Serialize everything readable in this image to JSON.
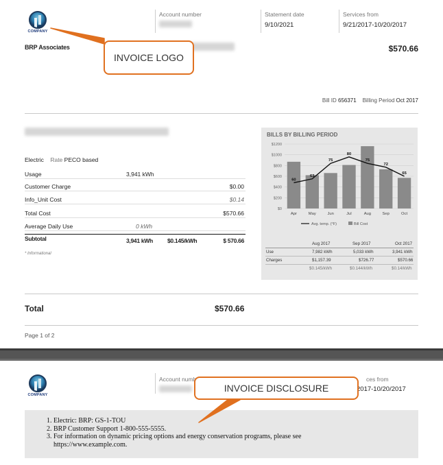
{
  "header": {
    "logo_text": "COMPANY",
    "account_label": "Account number",
    "statement_label": "Statement date",
    "statement_date": "9/10/2021",
    "services_label": "Services from",
    "services_range": "9/21/2017-10/20/2017",
    "company_name": "BRP Associates",
    "amount_due": "$570.66",
    "bill_id_label": "Bill ID",
    "bill_id": "656371",
    "billing_period_label": "Billing Period",
    "billing_period": "Oct 2017"
  },
  "callouts": {
    "logo": "INVOICE LOGO",
    "disclosure": "INVOICE DISCLOSURE"
  },
  "details": {
    "service_type": "Electric",
    "rate_label": "Rate",
    "rate_value": "PECO based",
    "rows": [
      {
        "label": "Usage",
        "mid": "3,941 kWh",
        "value": ""
      },
      {
        "label": "Customer Charge",
        "mid": "",
        "value": "$0.00"
      },
      {
        "label": "Info_Unit Cost",
        "mid": "",
        "value": "$0.14"
      },
      {
        "label": "Total Cost",
        "mid": "",
        "value": "$570.66"
      },
      {
        "label": "Average Daily Use",
        "mid": "0 kWh",
        "value": ""
      }
    ],
    "subtotal": {
      "label": "Subtotal",
      "usage": "3,941 kWh",
      "rate": "$0.145/kWh",
      "value": "$ 570.66"
    },
    "footnote": "* Informational"
  },
  "chart_data": {
    "type": "bar",
    "title": "BILLS BY BILLING PERIOD",
    "categories": [
      "Apr",
      "May",
      "Jun",
      "Jul",
      "Aug",
      "Sep",
      "Oct"
    ],
    "series": [
      {
        "name": "Bill Cost",
        "values": [
          870,
          620,
          660,
          810,
          1160,
          730,
          570
        ]
      },
      {
        "name": "Avg. temp. (°F)",
        "values": [
          60,
          63,
          75,
          80,
          75,
          72,
          65
        ]
      }
    ],
    "ylim": [
      0,
      1200
    ],
    "yticks": [
      "$0",
      "$200",
      "$400",
      "$600",
      "$800",
      "$1000",
      "$1200"
    ],
    "legend": "bottom",
    "colors": {
      "bar": "#8a8a8a",
      "line": "#111111",
      "panel": "#e7e7e7"
    }
  },
  "chart_table": {
    "periods": [
      "Aug 2017",
      "Sep 2017",
      "Oct 2017"
    ],
    "use_label": "Use",
    "use": [
      "7,982 kWh",
      "5,033 kWh",
      "3,941 kWh"
    ],
    "charges_label": "Charges",
    "charges": [
      "$1,157.39",
      "$726.77",
      "$570.66"
    ],
    "rates": [
      "$0.145/kWh",
      "$0.144/kWh",
      "$0.14/kWh"
    ]
  },
  "totals": {
    "label": "Total",
    "value": "$570.66",
    "page": "Page 1 of 2"
  },
  "page2": {
    "account_label": "Account number",
    "services_label": "Services from",
    "services_range_visible": "2017-10/20/2017",
    "services_label_visible": "ces from",
    "disclosure_items": [
      "Electric: BRP: GS-1-TOU",
      "BRP Customer Support 1-800-555-5555.",
      "For information on dynamic pricing options and energy conservation programs, please see https://www.example.com."
    ]
  }
}
